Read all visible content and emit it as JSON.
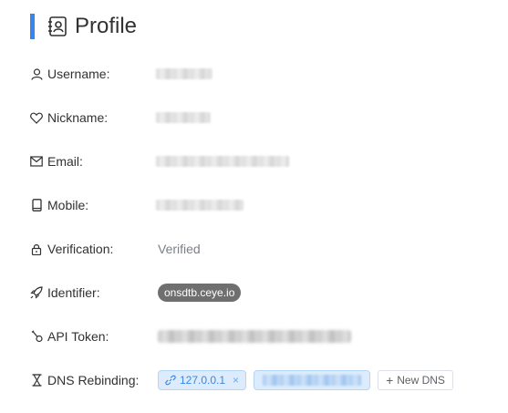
{
  "header": {
    "title": "Profile"
  },
  "fields": {
    "username": {
      "label": "Username:"
    },
    "nickname": {
      "label": "Nickname:"
    },
    "email": {
      "label": "Email:"
    },
    "mobile": {
      "label": "Mobile:"
    },
    "verification": {
      "label": "Verification:",
      "value": "Verified"
    },
    "identifier": {
      "label": "Identifier:",
      "value": "onsdtb.ceye.io"
    },
    "api_token": {
      "label": "API Token:"
    },
    "dns_rebinding": {
      "label": "DNS Rebinding:",
      "tags": [
        {
          "value": "127.0.0.1",
          "close": "×"
        }
      ],
      "new_button": "New DNS",
      "new_button_icon": "+"
    }
  },
  "colors": {
    "accent": "#3a86e8",
    "tag_bg": "#dcecfc",
    "identifier_bg": "#6f6f6f"
  }
}
